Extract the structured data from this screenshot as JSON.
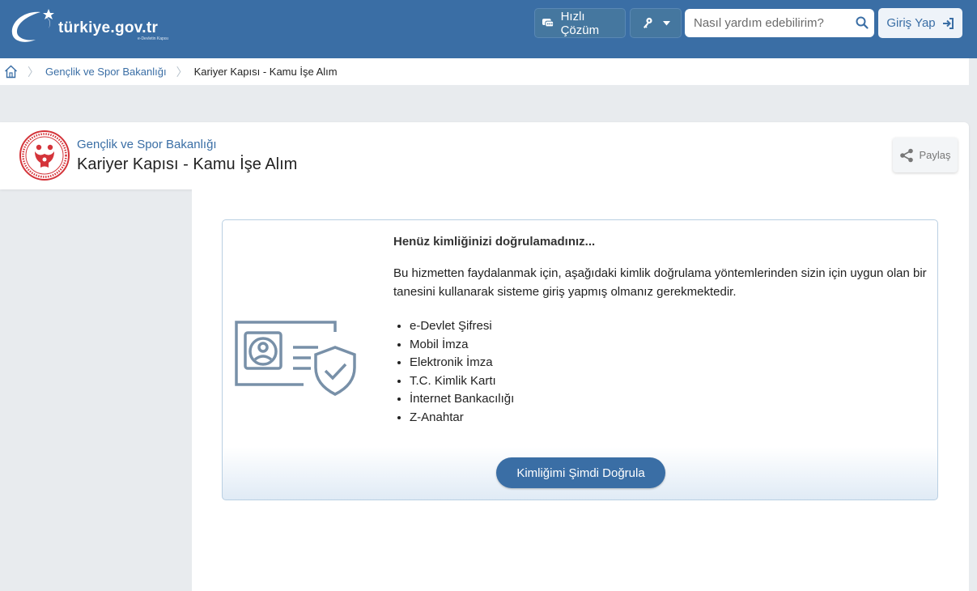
{
  "header": {
    "logo_text": "türkiye.gov.tr",
    "logo_subtext": "e-Devletin Kapısı",
    "quick_solution_label": "Hızlı Çözüm",
    "search_placeholder": "Nasıl yardım edebilirim?",
    "login_label": "Giriş Yap"
  },
  "breadcrumb": {
    "items": [
      "Gençlik ve Spor Bakanlığı",
      "Kariyer Kapısı - Kamu İşe Alım"
    ]
  },
  "service": {
    "ministry": "Gençlik ve Spor Bakanlığı",
    "title": "Kariyer Kapısı - Kamu İşe Alım",
    "share_label": "Paylaş"
  },
  "verification": {
    "title": "Henüz kimliğinizi doğrulamadınız...",
    "text": "Bu hizmetten faydalanmak için, aşağıdaki kimlik doğrulama yöntemlerinden sizin için uygun olan bir tanesini kullanarak sisteme giriş yapmış olmanız gerekmektedir.",
    "methods": [
      "e-Devlet Şifresi",
      "Mobil İmza",
      "Elektronik İmza",
      "T.C. Kimlik Kartı",
      "İnternet Bankacılığı",
      "Z-Anahtar"
    ],
    "button_label": "Kimliğimi Şimdi Doğrula"
  },
  "icons": {
    "logo": "turkiye-gov-logo-icon",
    "quick": "chat-icon",
    "key": "key-icon",
    "search": "search-icon",
    "login": "sign-in-icon",
    "home": "home-icon",
    "emblem": "ministry-emblem-icon",
    "share": "share-icon",
    "id_card": "id-card-shield-icon"
  },
  "colors": {
    "brand_blue": "#3a6ea5",
    "page_bg": "#e8ebee",
    "panel_border": "#b9cfe2",
    "emblem_red": "#d4343a"
  }
}
